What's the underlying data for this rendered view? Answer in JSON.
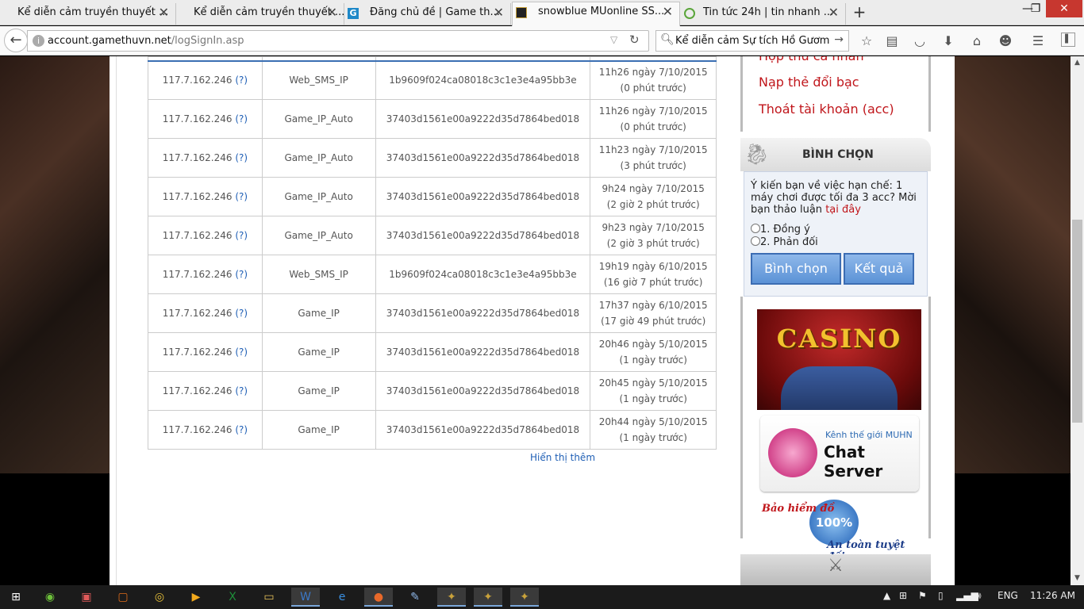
{
  "browser": {
    "tabs": [
      {
        "label": "Kể diễn cảm truyền thuyết ...",
        "active": false
      },
      {
        "label": "Kể diễn cảm truyền thuyết ...",
        "active": false
      },
      {
        "label": "Đăng chủ đề | Game th...",
        "active": false
      },
      {
        "label": "snowblue MUonline SS...",
        "active": true
      },
      {
        "label": "Tin tức 24h | tin nhanh ...",
        "active": false
      }
    ],
    "new_tab_label": "+",
    "window_buttons": {
      "minimize": "—",
      "maximize": "❐",
      "close": "✕"
    },
    "url_host": "account.gamethuvn.net",
    "url_path": "/logSignIn.asp",
    "search_text": "Kể diễn cảm Sự tích Hồ Gươm"
  },
  "log": {
    "rows": [
      {
        "ip": "117.7.162.246",
        "help": "(?)",
        "type": "Web_SMS_IP",
        "hash": "1b9609f024ca08018c3c1e3e4a95bb3e",
        "time": "11h26 ngày 7/10/2015",
        "ago": "(0 phút trước)"
      },
      {
        "ip": "117.7.162.246",
        "help": "(?)",
        "type": "Game_IP_Auto",
        "hash": "37403d1561e00a9222d35d7864bed018",
        "time": "11h26 ngày 7/10/2015",
        "ago": "(0 phút trước)"
      },
      {
        "ip": "117.7.162.246",
        "help": "(?)",
        "type": "Game_IP_Auto",
        "hash": "37403d1561e00a9222d35d7864bed018",
        "time": "11h23 ngày 7/10/2015",
        "ago": "(3 phút trước)"
      },
      {
        "ip": "117.7.162.246",
        "help": "(?)",
        "type": "Game_IP_Auto",
        "hash": "37403d1561e00a9222d35d7864bed018",
        "time": "9h24 ngày 7/10/2015",
        "ago": "(2 giờ 2 phút trước)"
      },
      {
        "ip": "117.7.162.246",
        "help": "(?)",
        "type": "Game_IP_Auto",
        "hash": "37403d1561e00a9222d35d7864bed018",
        "time": "9h23 ngày 7/10/2015",
        "ago": "(2 giờ 3 phút trước)"
      },
      {
        "ip": "117.7.162.246",
        "help": "(?)",
        "type": "Web_SMS_IP",
        "hash": "1b9609f024ca08018c3c1e3e4a95bb3e",
        "time": "19h19 ngày 6/10/2015",
        "ago": "(16 giờ 7 phút trước)"
      },
      {
        "ip": "117.7.162.246",
        "help": "(?)",
        "type": "Game_IP",
        "hash": "37403d1561e00a9222d35d7864bed018",
        "time": "17h37 ngày 6/10/2015",
        "ago": "(17 giờ 49 phút trước)"
      },
      {
        "ip": "117.7.162.246",
        "help": "(?)",
        "type": "Game_IP",
        "hash": "37403d1561e00a9222d35d7864bed018",
        "time": "20h46 ngày 5/10/2015",
        "ago": "(1 ngày trước)"
      },
      {
        "ip": "117.7.162.246",
        "help": "(?)",
        "type": "Game_IP",
        "hash": "37403d1561e00a9222d35d7864bed018",
        "time": "20h45 ngày 5/10/2015",
        "ago": "(1 ngày trước)"
      },
      {
        "ip": "117.7.162.246",
        "help": "(?)",
        "type": "Game_IP",
        "hash": "37403d1561e00a9222d35d7864bed018",
        "time": "20h44 ngày 5/10/2015",
        "ago": "(1 ngày trước)"
      }
    ],
    "show_more": "Hiển thị thêm"
  },
  "sidebar": {
    "menu": [
      "Hộp thư cá nhân",
      "Nạp thẻ đổi bạc",
      "Thoát tài khoản (acc)"
    ],
    "poll": {
      "title": "BÌNH CHỌN",
      "question": "Ý kiến bạn về việc hạn chế: 1 máy chơi được tối đa 3 acc? Mời bạn thảo luận",
      "question_link": "tại đây",
      "options": [
        "1. Đồng ý",
        "2. Phản đối"
      ],
      "vote_button": "Bình chọn",
      "result_button": "Kết quả"
    },
    "casino_label": "CASINO",
    "chat_sub": "Kênh thế giới MUHN",
    "chat_main": "Chat Server",
    "insurance_top": "Bảo hiểm đồ",
    "insurance_seal": "100%",
    "insurance_bottom": "An toàn tuyệt đối"
  },
  "taskbar": {
    "language": "ENG",
    "clock": "11:26 AM"
  },
  "colors": {
    "link_red": "#c0161b",
    "link_blue": "#1f5fb5",
    "table_header_line": "#3b6fb3"
  }
}
